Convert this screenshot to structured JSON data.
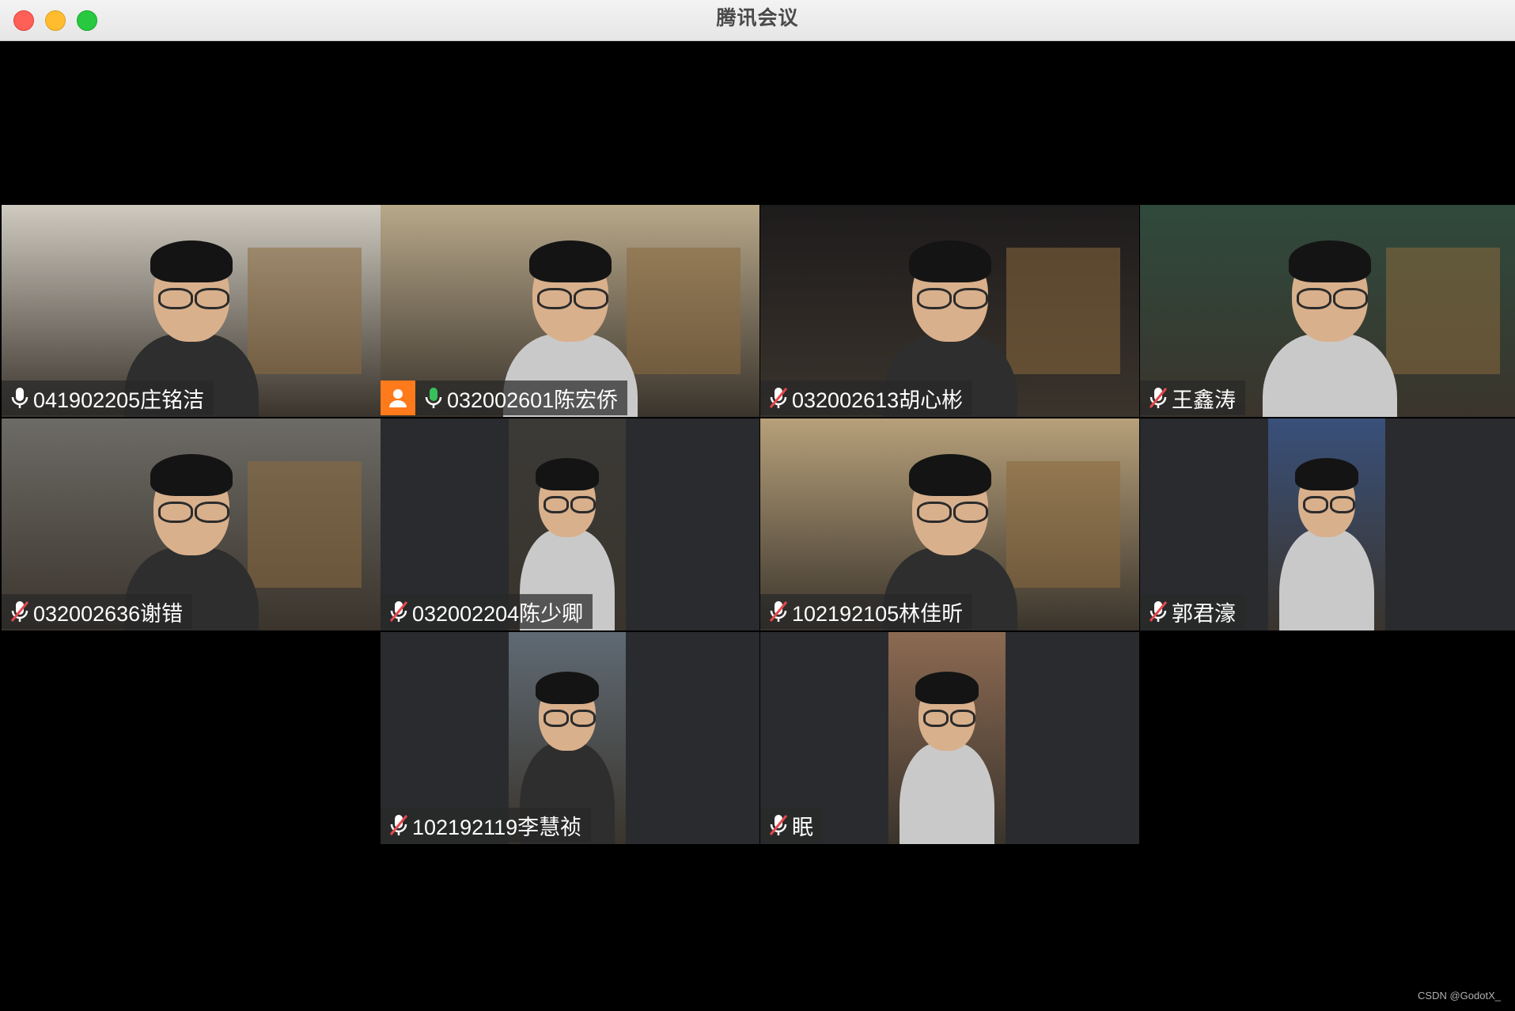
{
  "window": {
    "title": "腾讯会议"
  },
  "participants": [
    {
      "label": "041902205庄铭洁",
      "mic": "on-white",
      "speaking": true,
      "host_badge": false,
      "video": "full",
      "scene": "#cfcac0"
    },
    {
      "label": "032002601陈宏侨",
      "mic": "on-green",
      "speaking": false,
      "host_badge": true,
      "video": "full",
      "scene": "#b8a88a"
    },
    {
      "label": "032002613胡心彬",
      "mic": "muted",
      "speaking": false,
      "host_badge": false,
      "video": "full",
      "scene": "#1e1b1c"
    },
    {
      "label": "王鑫涛",
      "mic": "muted",
      "speaking": false,
      "host_badge": false,
      "video": "full",
      "scene": "#2f4a3c"
    },
    {
      "label": "032002636谢错",
      "mic": "muted",
      "speaking": false,
      "host_badge": false,
      "video": "full",
      "scene": "#6d6b66"
    },
    {
      "label": "032002204陈少卿",
      "mic": "muted",
      "speaking": false,
      "host_badge": false,
      "video": "portrait",
      "scene": "#3b3a37"
    },
    {
      "label": "102192105林佳昕",
      "mic": "muted",
      "speaking": false,
      "host_badge": false,
      "video": "full",
      "scene": "#b7a07a"
    },
    {
      "label": "郭君濠",
      "mic": "muted",
      "speaking": false,
      "host_badge": false,
      "video": "portrait",
      "scene": "#39507a"
    },
    {
      "label": "102192119李慧祯",
      "mic": "muted",
      "speaking": false,
      "host_badge": false,
      "video": "portrait",
      "scene": "#5f6a74"
    },
    {
      "label": "眠",
      "mic": "muted",
      "speaking": false,
      "host_badge": false,
      "video": "portrait",
      "scene": "#8c6a52"
    }
  ],
  "colors": {
    "speaking_border": "#38c15a",
    "host_badge": "#ff7a1a",
    "mic_muted": "#e5484d",
    "mic_active": "#38c15a"
  },
  "watermark": "CSDN @GodotX_"
}
